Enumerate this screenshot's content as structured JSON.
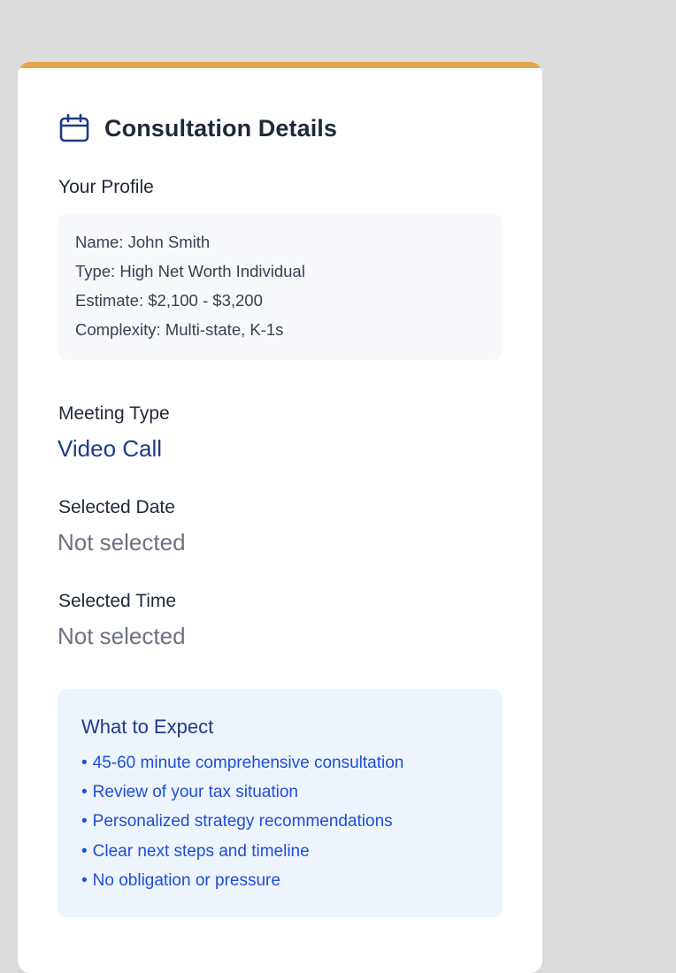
{
  "card": {
    "title": "Consultation Details",
    "icon": "calendar-icon",
    "accent_color": "#e2a84b"
  },
  "profile": {
    "label": "Your Profile",
    "lines": [
      {
        "key": "Name:",
        "value": "John Smith"
      },
      {
        "key": "Type:",
        "value": "High Net Worth Individual"
      },
      {
        "key": "Estimate:",
        "value": "$2,100 - $3,200"
      },
      {
        "key": "Complexity:",
        "value": "Multi-state, K-1s"
      }
    ]
  },
  "meeting": {
    "label": "Meeting Type",
    "value": "Video Call"
  },
  "date": {
    "label": "Selected Date",
    "value": "Not selected"
  },
  "time": {
    "label": "Selected Time",
    "value": "Not selected"
  },
  "expect": {
    "title": "What to Expect",
    "bullet": "•",
    "items": [
      "45-60 minute comprehensive consultation",
      "Review of your tax situation",
      "Personalized strategy recommendations",
      "Clear next steps and timeline",
      "No obligation or pressure"
    ]
  }
}
